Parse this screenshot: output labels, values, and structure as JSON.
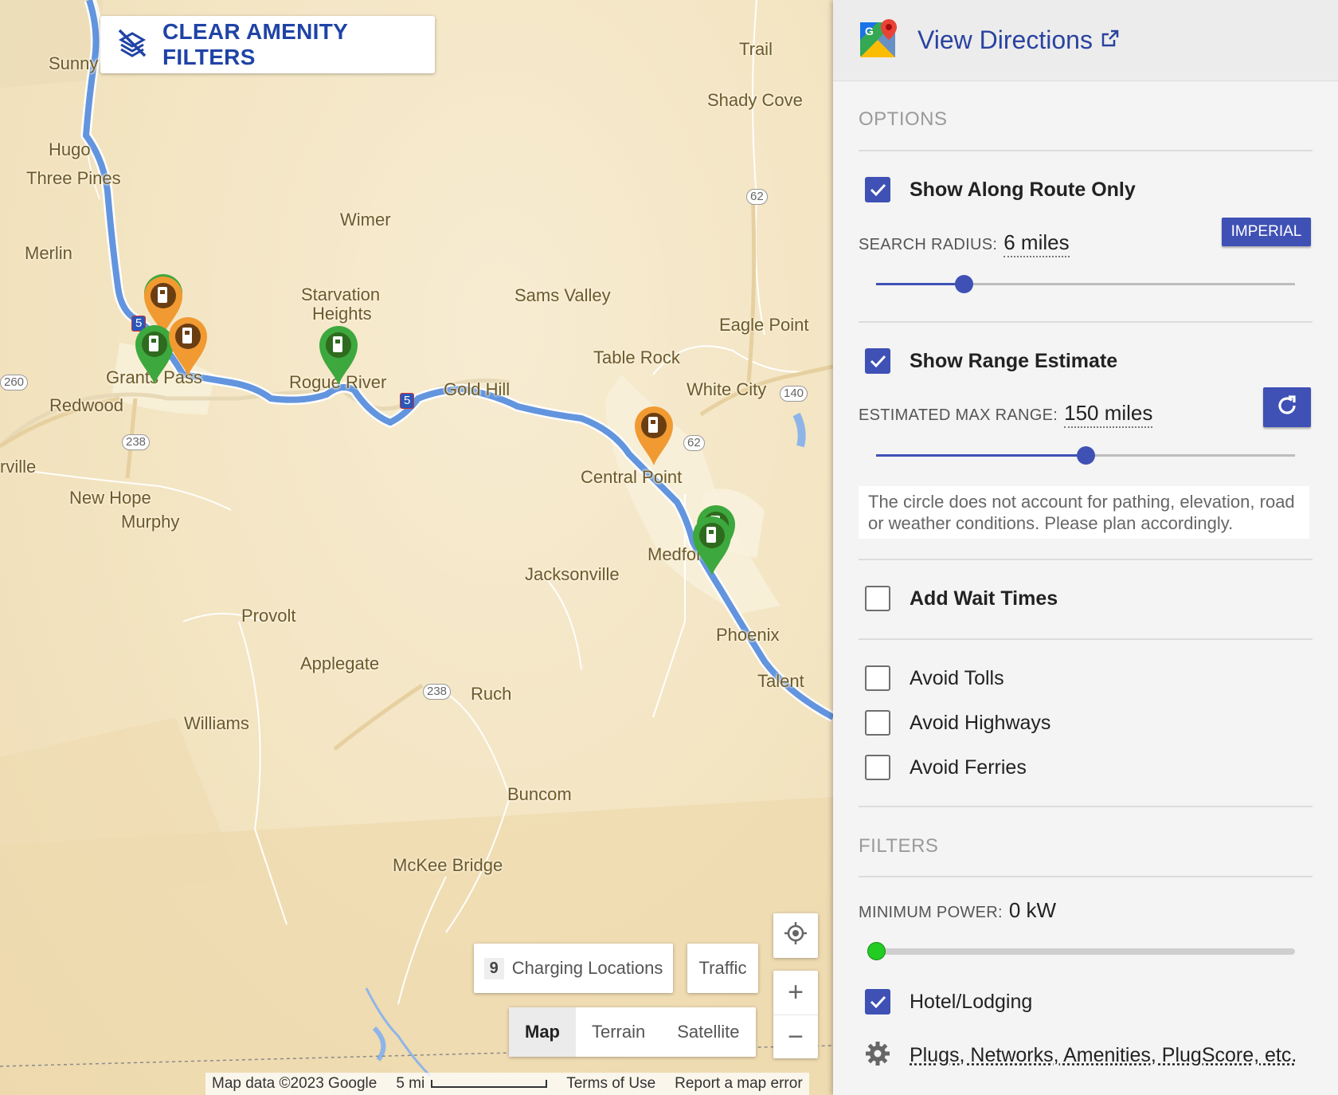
{
  "map": {
    "clear_filters_label": "CLEAR AMENITY FILTERS",
    "places": [
      {
        "name": "Sunny",
        "id": "sunny"
      },
      {
        "name": "Hugo",
        "id": "hugo"
      },
      {
        "name": "Three Pines",
        "id": "three-pines"
      },
      {
        "name": "Merlin",
        "id": "merlin"
      },
      {
        "name": "Wimer",
        "id": "wimer"
      },
      {
        "name": "Starvation",
        "id": "starvation"
      },
      {
        "name": "Heights",
        "id": "heights"
      },
      {
        "name": "Sams Valley",
        "id": "sams-valley"
      },
      {
        "name": "Eagle Point",
        "id": "eagle-point"
      },
      {
        "name": "Trail",
        "id": "trail"
      },
      {
        "name": "Shady Cove",
        "id": "shady-cove"
      },
      {
        "name": "Table Rock",
        "id": "table-rock"
      },
      {
        "name": "White City",
        "id": "white-city"
      },
      {
        "name": "Gold Hill",
        "id": "gold-hill"
      },
      {
        "name": "Rogue River",
        "id": "rogue-river"
      },
      {
        "name": "Grants Pass",
        "id": "grants-pass"
      },
      {
        "name": "Redwood",
        "id": "redwood"
      },
      {
        "name": "rville",
        "id": "rville"
      },
      {
        "name": "New Hope",
        "id": "new-hope"
      },
      {
        "name": "Murphy",
        "id": "murphy"
      },
      {
        "name": "Central Point",
        "id": "central-point"
      },
      {
        "name": "Medford",
        "id": "medford"
      },
      {
        "name": "Jacksonville",
        "id": "jacksonville"
      },
      {
        "name": "Phoenix",
        "id": "phoenix"
      },
      {
        "name": "Talent",
        "id": "talent"
      },
      {
        "name": "Provolt",
        "id": "provolt"
      },
      {
        "name": "Applegate",
        "id": "applegate"
      },
      {
        "name": "Ruch",
        "id": "ruch"
      },
      {
        "name": "Williams",
        "id": "williams"
      },
      {
        "name": "Buncom",
        "id": "buncom"
      },
      {
        "name": "McKee Bridge",
        "id": "mckee-bridge"
      }
    ],
    "shields": [
      "62",
      "260",
      "238",
      "140",
      "62",
      "238",
      "5",
      "5"
    ],
    "charging_count": "9",
    "charging_label": "Charging Locations",
    "traffic_label": "Traffic",
    "map_types": [
      "Map",
      "Terrain",
      "Satellite"
    ],
    "active_map_type": "Map",
    "attribution": {
      "map_data": "Map data ©2023 Google",
      "scale": "5 mi",
      "terms": "Terms of Use",
      "report": "Report a map error"
    },
    "colors": {
      "route": "#5b8fdc",
      "pin_green": "#3da83d",
      "pin_orange": "#f19a32",
      "pin_icon_bg": "#6b3e12"
    }
  },
  "panel": {
    "header": {
      "title": "View Directions",
      "icon": "google-maps-icon",
      "ext_icon": "external-link-icon"
    },
    "options_label": "OPTIONS",
    "show_along_route": {
      "label": "Show Along Route Only",
      "checked": true
    },
    "search_radius": {
      "label": "SEARCH RADIUS:",
      "value": "6 miles",
      "fraction": 0.21
    },
    "units_button": "IMPERIAL",
    "show_range": {
      "label": "Show Range Estimate",
      "checked": true
    },
    "max_range": {
      "label": "ESTIMATED MAX RANGE:",
      "value": "150 miles",
      "fraction": 0.5
    },
    "range_note": "The circle does not account for pathing, elevation, road or weather conditions. Please plan accordingly.",
    "add_wait_times": {
      "label": "Add Wait Times",
      "checked": false
    },
    "avoid_tolls": {
      "label": "Avoid Tolls",
      "checked": false
    },
    "avoid_highways": {
      "label": "Avoid Highways",
      "checked": false
    },
    "avoid_ferries": {
      "label": "Avoid Ferries",
      "checked": false
    },
    "filters_label": "FILTERS",
    "min_power": {
      "label": "MINIMUM POWER:",
      "value": "0 kW",
      "fraction": 0.0
    },
    "hotel_lodging": {
      "label": "Hotel/Lodging",
      "checked": true
    },
    "more_filters": "Plugs, Networks, Amenities, PlugScore, etc.",
    "accent": "#3f51b5"
  }
}
